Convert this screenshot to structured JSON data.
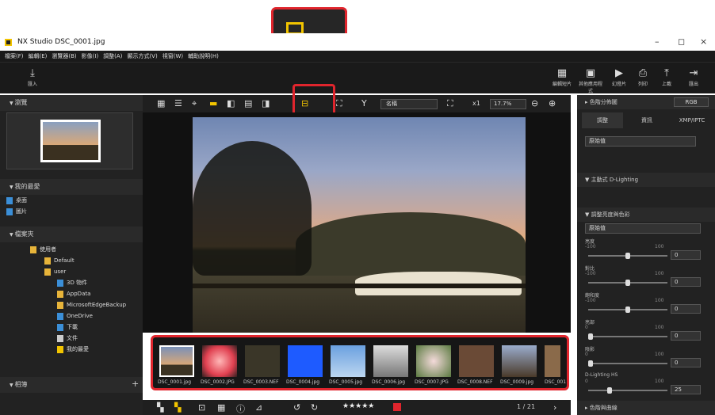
{
  "window": {
    "app_title": "NX Studio   DSC_0001.jpg",
    "min": "–",
    "max": "◻",
    "close": "×"
  },
  "menu": [
    "檔案(F)",
    "編輯(E)",
    "瀏覽器(B)",
    "影像(I)",
    "調整(A)",
    "顯示方式(V)",
    "視窗(W)",
    "輔助說明(H)"
  ],
  "toolbar": {
    "import": "匯入",
    "right": [
      "編輯短片",
      "其他應用程式",
      "幻燈片",
      "列印",
      "上載",
      "匯出"
    ]
  },
  "left": {
    "browse": "瀏覽",
    "favorites": "我的最愛",
    "fav_items": [
      "桌面",
      "圖片"
    ],
    "folders": "檔案夾",
    "tree": [
      "使用者",
      "Default",
      "user",
      "3D 物件",
      "AppData",
      "MicrosoftEdgeBackup",
      "OneDrive",
      "下載",
      "文件",
      "我的最愛"
    ],
    "albums": "相簿"
  },
  "center": {
    "sort": "名稱",
    "zoom_fit": "x1",
    "zoom": "17.7%",
    "page": "1 / 21"
  },
  "files": [
    "DSC_0001.jpg",
    "DSC_0002.JPG",
    "DSC_0003.NEF",
    "DSC_0004.jpg",
    "DSC_0005.jpg",
    "DSC_0006.jpg",
    "DSC_0007.JPG",
    "DSC_0008.NEF",
    "DSC_0009.jpg",
    "DSC_001"
  ],
  "right": {
    "histogram": "色階分佈圖",
    "hist_mode": "RGB",
    "tabs": [
      "調整",
      "資訊",
      "XMP/IPTC"
    ],
    "preset": "原始值",
    "adl": "主動式 D-Lighting",
    "brightness": "調整亮度與色彩",
    "bright_preset": "原始值",
    "sliders": [
      {
        "label": "亮度",
        "min": "-100",
        "max": "100",
        "value": "0"
      },
      {
        "label": "對比",
        "min": "-100",
        "max": "100",
        "value": "0"
      },
      {
        "label": "飽和度",
        "min": "-100",
        "max": "100",
        "value": "0"
      },
      {
        "label": "亮部",
        "min": "0",
        "max": "100",
        "value": "0"
      },
      {
        "label": "陰影",
        "min": "0",
        "max": "100",
        "value": "0"
      },
      {
        "label": "D-Lighting HS",
        "min": "0",
        "max": "100",
        "value": "25"
      }
    ],
    "curves": "色階與曲線"
  }
}
